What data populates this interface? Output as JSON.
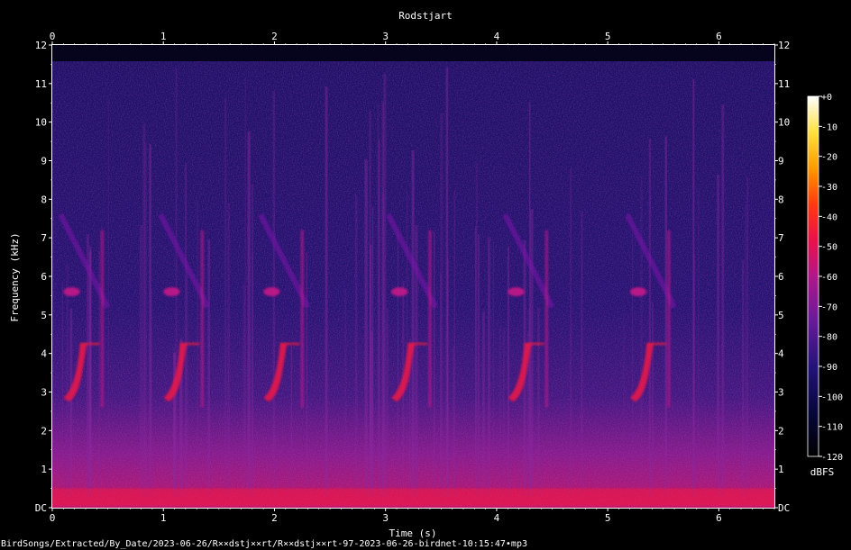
{
  "chart_data": {
    "type": "heatmap",
    "title": "Rodstjart",
    "xlabel": "Time (s)",
    "ylabel": "Frequency (kHz)",
    "xlim": [
      0,
      6.5
    ],
    "ylim": [
      0,
      12
    ],
    "x_ticks": [
      "0",
      "1",
      "2",
      "3",
      "4",
      "5",
      "6"
    ],
    "y_ticks": [
      "DC",
      "1",
      "2",
      "3",
      "4",
      "5",
      "6",
      "7",
      "8",
      "9",
      "10",
      "11",
      "12"
    ],
    "colorbar": {
      "label": "dBFS",
      "ticks": [
        "+0",
        "-10",
        "-20",
        "-30",
        "-40",
        "-50",
        "-60",
        "-70",
        "-80",
        "-90",
        "-100",
        "-110",
        "-120"
      ],
      "range": [
        -120,
        0
      ]
    },
    "calls_start_s": [
      0.1,
      1.0,
      1.9,
      3.05,
      4.1,
      5.2
    ]
  },
  "footer": "BirdSongs/Extracted/By_Date/2023-06-26/R××dstj××rt/R××dstj××rt-97-2023-06-26-birdnet-10:15:47•mp3"
}
